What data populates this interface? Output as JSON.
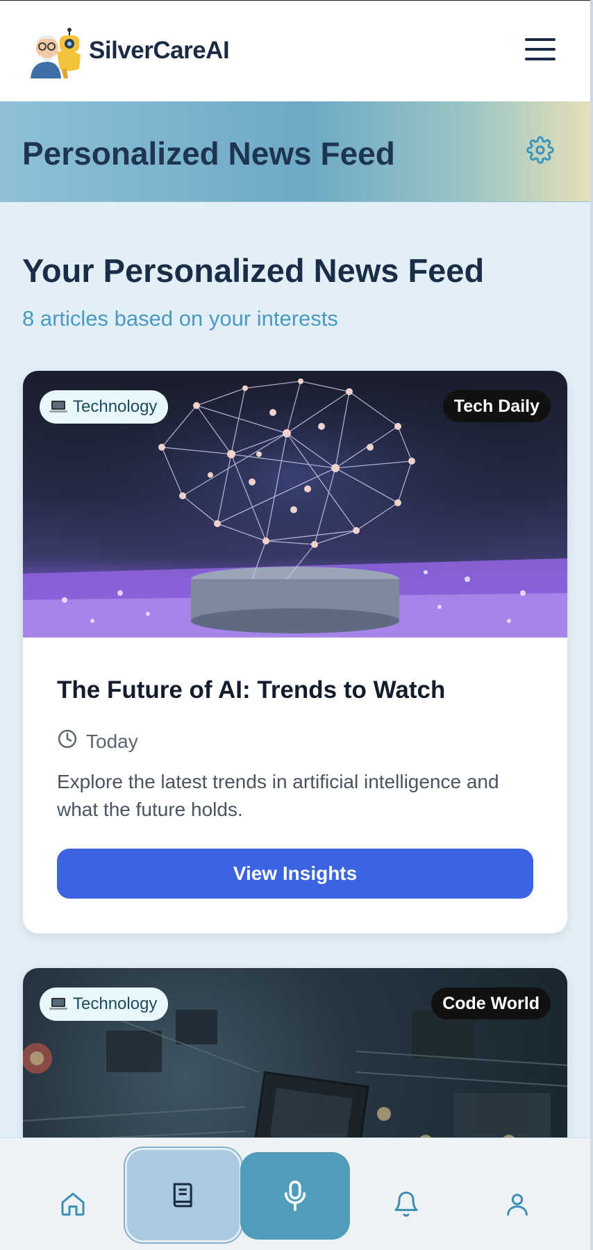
{
  "header": {
    "brand": "SilverCareAI",
    "logo_icon": "elderly-man-and-robot-logo",
    "menu_icon": "hamburger-icon"
  },
  "banner": {
    "title": "Personalized News Feed",
    "settings_icon": "gear-icon"
  },
  "feed": {
    "heading": "Your Personalized News Feed",
    "subheading": "8 articles based on your interests"
  },
  "articles": [
    {
      "category": "Technology",
      "category_icon": "laptop-icon",
      "source": "Tech Daily",
      "title": "The Future of AI: Trends to Watch",
      "date": "Today",
      "description": "Explore the latest trends in artificial intelligence and what the future holds.",
      "cta": "View Insights"
    },
    {
      "category": "Technology",
      "category_icon": "laptop-icon",
      "source": "Code World"
    }
  ],
  "bottom_nav": {
    "items": [
      "home-icon",
      "book-icon",
      "microphone-icon",
      "bell-icon",
      "user-icon"
    ],
    "active": "book-icon"
  },
  "colors": {
    "primary_button": "#3b63e2",
    "accent": "#4f9dba",
    "text_dark": "#1a2d46",
    "subtitle": "#4a9ac0"
  }
}
